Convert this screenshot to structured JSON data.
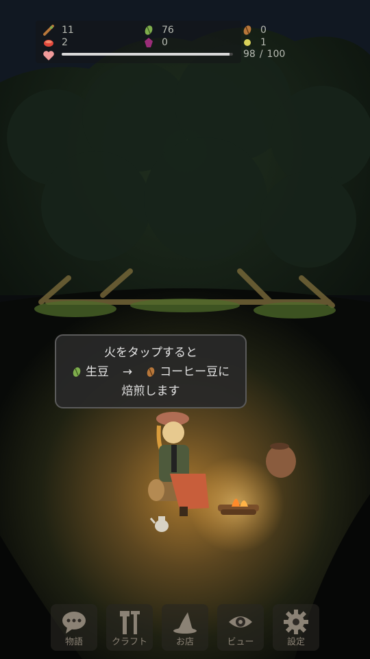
{
  "resources": {
    "wood": "11",
    "green_beans": "76",
    "roasted_beans": "0",
    "meat": "2",
    "gem": "0",
    "coin": "1"
  },
  "hp": {
    "current": "98",
    "separator": "/",
    "max": "100",
    "fraction": 0.98
  },
  "tooltip": {
    "line1": "火をタップすると",
    "line2_left": "生豆",
    "line2_arrow": "→",
    "line2_right": "コーヒー豆に",
    "line3": "焙煎します"
  },
  "nav": [
    {
      "label": "物語",
      "icon": "chat-bubble-icon"
    },
    {
      "label": "クラフト",
      "icon": "tools-icon"
    },
    {
      "label": "お店",
      "icon": "witch-hat-icon"
    },
    {
      "label": "ビュー",
      "icon": "eye-icon"
    },
    {
      "label": "設定",
      "icon": "gear-icon"
    }
  ],
  "colors": {
    "green_bean": "#7fae4d",
    "roasted_bean": "#b8773a",
    "fire": "#ffb347",
    "hp_fill": "#d9d9d9"
  }
}
